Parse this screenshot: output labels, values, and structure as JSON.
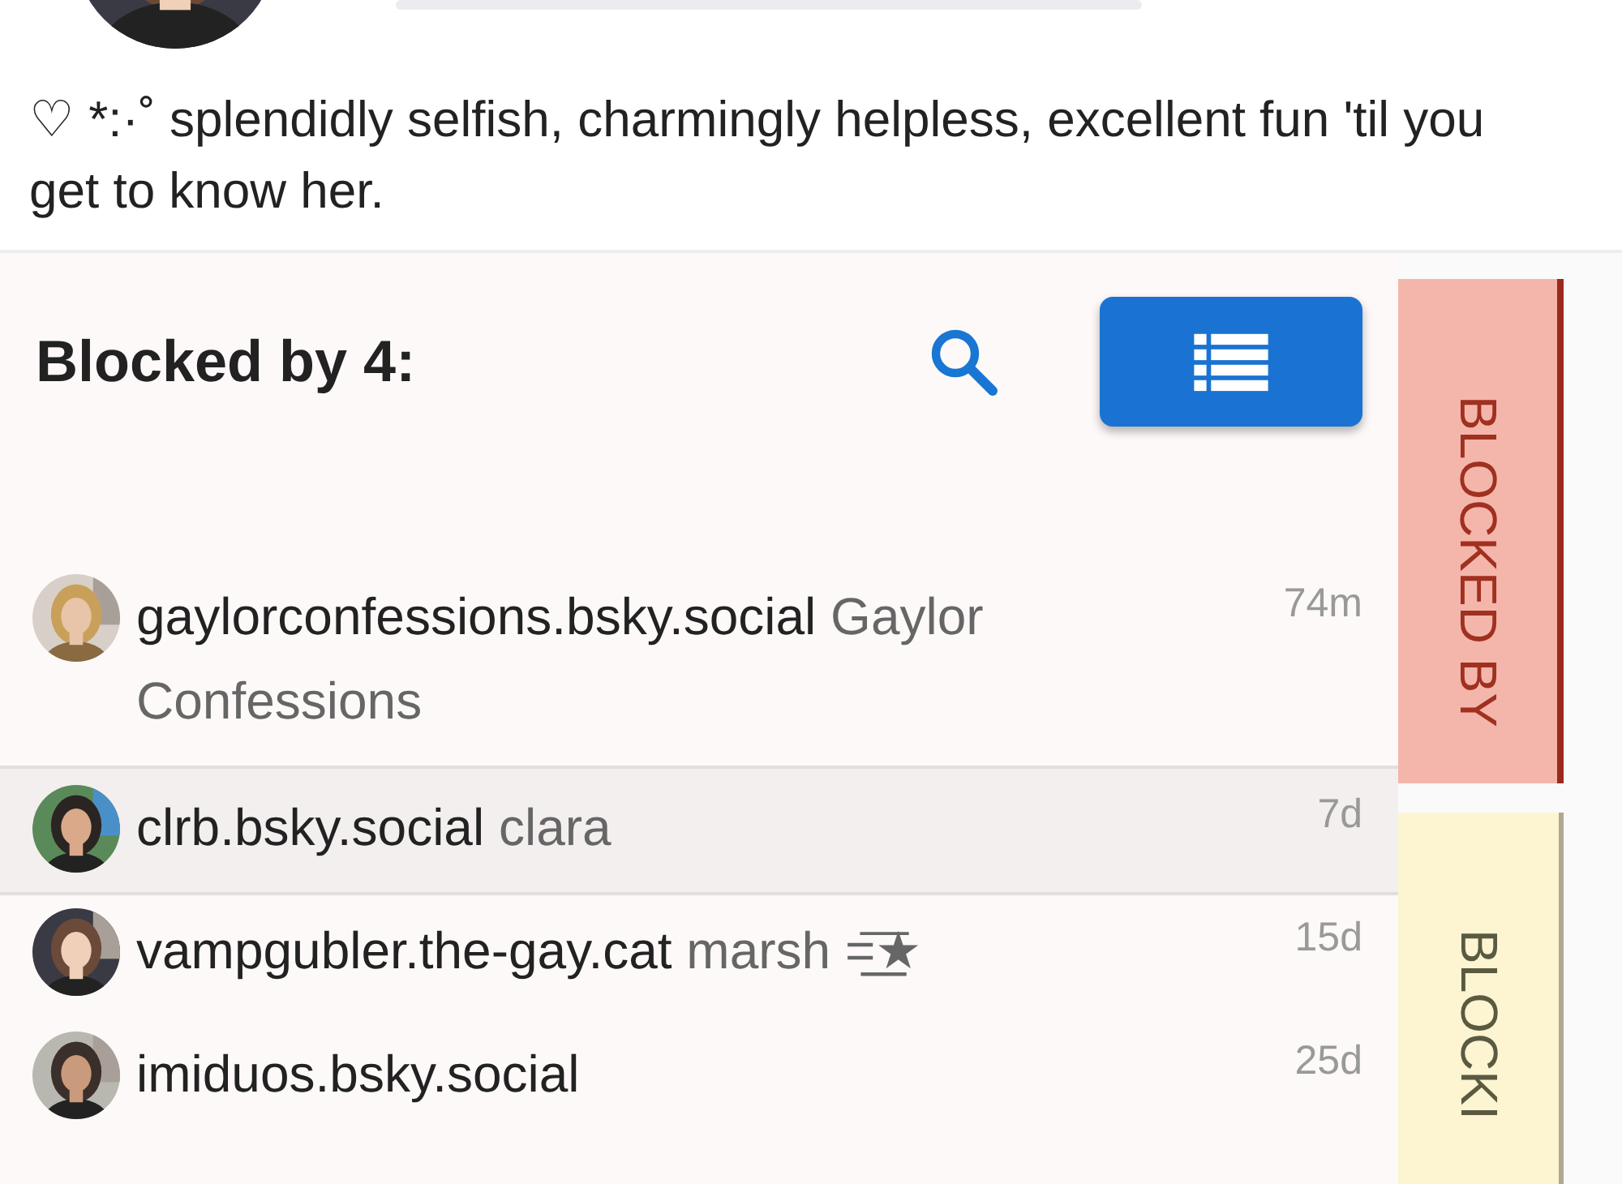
{
  "profile": {
    "bio": "♡ *:·˚ splendidly selfish, charmingly helpless, excellent fun 'til you get to know her."
  },
  "panel": {
    "heading": "Blocked by 4:",
    "rows": [
      {
        "handle": "gaylorconfessions.bsky.social",
        "display_name": "Gaylor Confessions",
        "time": "74m",
        "selected": false
      },
      {
        "handle": "clrb.bsky.social",
        "display_name": "clara",
        "time": "7d",
        "selected": true
      },
      {
        "handle": "vampgubler.the-gay.cat",
        "display_name": "marsh =͟͟͞★",
        "time": "15d",
        "selected": false
      },
      {
        "handle": "imiduos.bsky.social",
        "time": "25d",
        "selected": false
      }
    ]
  },
  "side_tabs": [
    {
      "label": "BLOCKED BY",
      "selected": true,
      "color": "#f4b6ab"
    },
    {
      "label": "BLOCKI",
      "selected": false,
      "color": "#fdf4d2"
    }
  ]
}
